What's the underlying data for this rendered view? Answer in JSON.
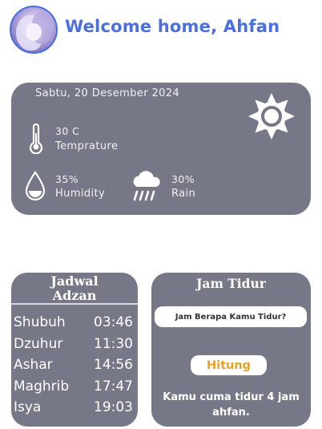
{
  "header": {
    "title": "Welcome home, Ahfan"
  },
  "weather": {
    "date": "Sabtu, 20 Desember 2024",
    "condition_icon": "sun-icon",
    "temperature": {
      "value": "30 C",
      "label": "Temprature",
      "icon": "thermometer-icon"
    },
    "humidity": {
      "value": "35%",
      "label": "Humidity",
      "icon": "water-drop-icon"
    },
    "rain": {
      "value": "30%",
      "label": "Rain",
      "icon": "rain-cloud-icon"
    }
  },
  "adzan": {
    "title": "Jadwal Adzan",
    "prayers": [
      {
        "name": "Shubuh",
        "time": "03:46"
      },
      {
        "name": "Dzuhur",
        "time": "11:30"
      },
      {
        "name": "Ashar",
        "time": "14:56"
      },
      {
        "name": "Maghrib",
        "time": "17:47"
      },
      {
        "name": "Isya",
        "time": "19:03"
      }
    ]
  },
  "sleep": {
    "title": "Jam Tidur",
    "input_placeholder": "Jam Berapa Kamu Tidur?",
    "input_value": "",
    "button_label": "Hitung",
    "result": "Kamu cuma tidur 4 jam ahfan."
  },
  "colors": {
    "accent": "#4a6fe0",
    "card_bg": "#767787",
    "button_text": "#f0a020"
  }
}
